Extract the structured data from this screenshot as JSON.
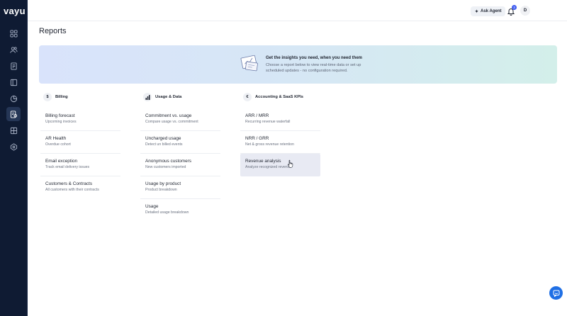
{
  "app": {
    "logo": "vayu"
  },
  "sidebar": {
    "items": [
      {
        "name": "dashboard-icon",
        "active": false
      },
      {
        "name": "customers-icon",
        "active": false
      },
      {
        "name": "invoices-icon",
        "active": false
      },
      {
        "name": "contracts-icon",
        "active": false
      },
      {
        "name": "analytics-icon",
        "active": false
      },
      {
        "name": "reports-icon",
        "active": true
      },
      {
        "name": "products-icon",
        "active": false
      },
      {
        "name": "integrations-icon",
        "active": false
      }
    ]
  },
  "topbar": {
    "ask_agent_label": "Ask Agent",
    "notification_count": "3",
    "avatar_initial": "D"
  },
  "page": {
    "title": "Reports"
  },
  "banner": {
    "heading": "Get the insights you need, when you need them",
    "text": "Choose a report below to view real-time data or set up scheduled updates - no configuration required."
  },
  "columns": [
    {
      "icon": "$",
      "title": "Billing",
      "reports": [
        {
          "title": "Billing forecast",
          "desc": "Upcoming invoices"
        },
        {
          "title": "AR Health",
          "desc": "Overdue cohort"
        },
        {
          "title": "Email exception",
          "desc": "Track email delivery issues"
        },
        {
          "title": "Customers & Contracts",
          "desc": "All customers with their contracts"
        }
      ]
    },
    {
      "icon": "chart",
      "title": "Usage & Data",
      "reports": [
        {
          "title": "Commitment vs. usage",
          "desc": "Compare usage vs. commitment"
        },
        {
          "title": "Uncharged usage",
          "desc": "Detect un billed events"
        },
        {
          "title": "Anonymous customers",
          "desc": "New customers imported"
        },
        {
          "title": "Usage by product",
          "desc": "Product breakdown"
        },
        {
          "title": "Usage",
          "desc": "Detailed usage breakdown"
        }
      ]
    },
    {
      "icon": "€",
      "title": "Accounting & SaaS KPIs",
      "reports": [
        {
          "title": "ARR / MRR",
          "desc": "Recurring revenue waterfall"
        },
        {
          "title": "NRR / GRR",
          "desc": "Net & gross revenue retention"
        },
        {
          "title": "Revenue analysis",
          "desc": "Analyze recognized revenue"
        }
      ]
    }
  ],
  "colors": {
    "sidebar_bg": "#0f1b33",
    "accent": "#3d5af1",
    "chat_button": "#1f6fe5",
    "hover_row": "#e8eaf3"
  }
}
